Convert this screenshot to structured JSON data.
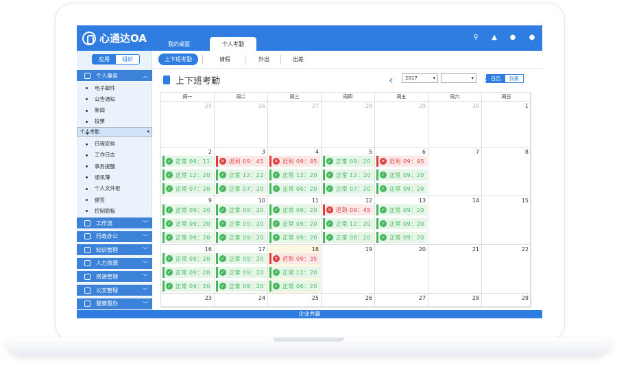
{
  "app": {
    "name": "心通达OA",
    "footer": "企业共赢"
  },
  "top_tabs": [
    "我的桌面",
    "个人考勤"
  ],
  "top_icons": [
    "search-icon",
    "bell-icon",
    "skin-icon",
    "user-icon"
  ],
  "left": {
    "segment": [
      "应用",
      "组织"
    ],
    "sections": [
      {
        "name": "personal",
        "label": "个人事务",
        "expanded": true
      },
      {
        "name": "workflow",
        "label": "工作流"
      },
      {
        "name": "admin",
        "label": "行政办公"
      },
      {
        "name": "knowledge",
        "label": "知识管理"
      },
      {
        "name": "hr",
        "label": "人力资源"
      },
      {
        "name": "resource",
        "label": "资源管理"
      },
      {
        "name": "doc",
        "label": "公文管理"
      },
      {
        "name": "supervise",
        "label": "督察督办"
      }
    ],
    "sub_items": [
      "电子邮件",
      "公告通知",
      "新闻",
      "投票",
      "个人考勤",
      "日程安排",
      "工作日志",
      "事务提醒",
      "通讯薄",
      "个人文件柜",
      "便签",
      "控制面板"
    ],
    "selected_sub": "个人考勤"
  },
  "sub_tabs": [
    "上下班考勤",
    "请假",
    "外出",
    "出差"
  ],
  "page_title": "上下班考勤",
  "year": "2017",
  "month": "",
  "view_toggle": [
    "日历",
    "列表"
  ],
  "weekdays": [
    "周一",
    "周二",
    "周三",
    "周四",
    "周五",
    "周六",
    "周日"
  ],
  "weeks": [
    [
      {
        "d": "25",
        "o": true
      },
      {
        "d": "26",
        "o": true
      },
      {
        "d": "27",
        "o": true
      },
      {
        "d": "28",
        "o": true
      },
      {
        "d": "29",
        "o": true
      },
      {
        "d": "30",
        "o": true
      },
      {
        "d": "1"
      }
    ],
    [
      {
        "d": "2",
        "e": [
          [
            "ok",
            "正常 09：11"
          ],
          [
            "ok",
            "正常 12：20"
          ],
          [
            "ok",
            "正常 07：20"
          ]
        ]
      },
      {
        "d": "3",
        "e": [
          [
            "late",
            "迟到 09：45"
          ],
          [
            "ok",
            "正常 12：22"
          ],
          [
            "ok",
            "正常 07：20"
          ]
        ]
      },
      {
        "d": "4",
        "e": [
          [
            "late",
            "迟到 09：45"
          ],
          [
            "ok",
            "正常 12：20"
          ],
          [
            "ok",
            "正常 06：20"
          ]
        ]
      },
      {
        "d": "5",
        "e": [
          [
            "ok",
            "正常 09：20"
          ],
          [
            "ok",
            "正常 12：20"
          ],
          [
            "ok",
            "正常 07：20"
          ]
        ]
      },
      {
        "d": "6",
        "e": [
          [
            "late",
            "迟到 09：45"
          ],
          [
            "ok",
            "正常 09：20"
          ],
          [
            "ok",
            "正常 09：20"
          ]
        ]
      },
      {
        "d": "7"
      },
      {
        "d": "8"
      }
    ],
    [
      {
        "d": "9",
        "e": [
          [
            "ok",
            "正常 09：20"
          ],
          [
            "ok",
            "正常 09：20"
          ],
          [
            "ok",
            "正常 09：20"
          ]
        ]
      },
      {
        "d": "10",
        "e": [
          [
            "ok",
            "正常 09：20"
          ],
          [
            "ok",
            "正常 09：20"
          ],
          [
            "ok",
            "正常 09：20"
          ]
        ]
      },
      {
        "d": "11",
        "e": [
          [
            "ok",
            "正常 09：20"
          ],
          [
            "ok",
            "正常 09：20"
          ],
          [
            "ok",
            "正常 09：20"
          ]
        ]
      },
      {
        "d": "12",
        "e": [
          [
            "late",
            "迟到 09：45"
          ],
          [
            "ok",
            "正常 12：20"
          ],
          [
            "ok",
            "正常 08：20"
          ]
        ]
      },
      {
        "d": "13",
        "e": [
          [
            "ok",
            "正常 09：20"
          ],
          [
            "ok",
            "正常 09：20"
          ],
          [
            "ok",
            "正常 09：20"
          ]
        ]
      },
      {
        "d": "14"
      },
      {
        "d": "15"
      }
    ],
    [
      {
        "d": "16",
        "e": [
          [
            "ok",
            "正常 09：20"
          ],
          [
            "ok",
            "正常 09：20"
          ],
          [
            "ok",
            "正常 09：20"
          ]
        ]
      },
      {
        "d": "17",
        "e": [
          [
            "ok",
            "正常 09：20"
          ],
          [
            "ok",
            "正常 09：20"
          ],
          [
            "ok",
            "正常 09：20"
          ]
        ]
      },
      {
        "d": "18",
        "t": true,
        "e": [
          [
            "late",
            "迟到 09：35"
          ],
          [
            "ok",
            "正常 12：20"
          ],
          [
            "ok",
            "正常 06：20"
          ]
        ]
      },
      {
        "d": "19"
      },
      {
        "d": "20"
      },
      {
        "d": "21"
      },
      {
        "d": "22"
      }
    ],
    [
      {
        "d": "23"
      },
      {
        "d": "24"
      },
      {
        "d": "25"
      },
      {
        "d": "26"
      },
      {
        "d": "27"
      },
      {
        "d": "28"
      },
      {
        "d": "29"
      }
    ]
  ],
  "colors": {
    "primary": "#2f7de1",
    "ok": "#45b85d",
    "late": "#e03c3c"
  }
}
